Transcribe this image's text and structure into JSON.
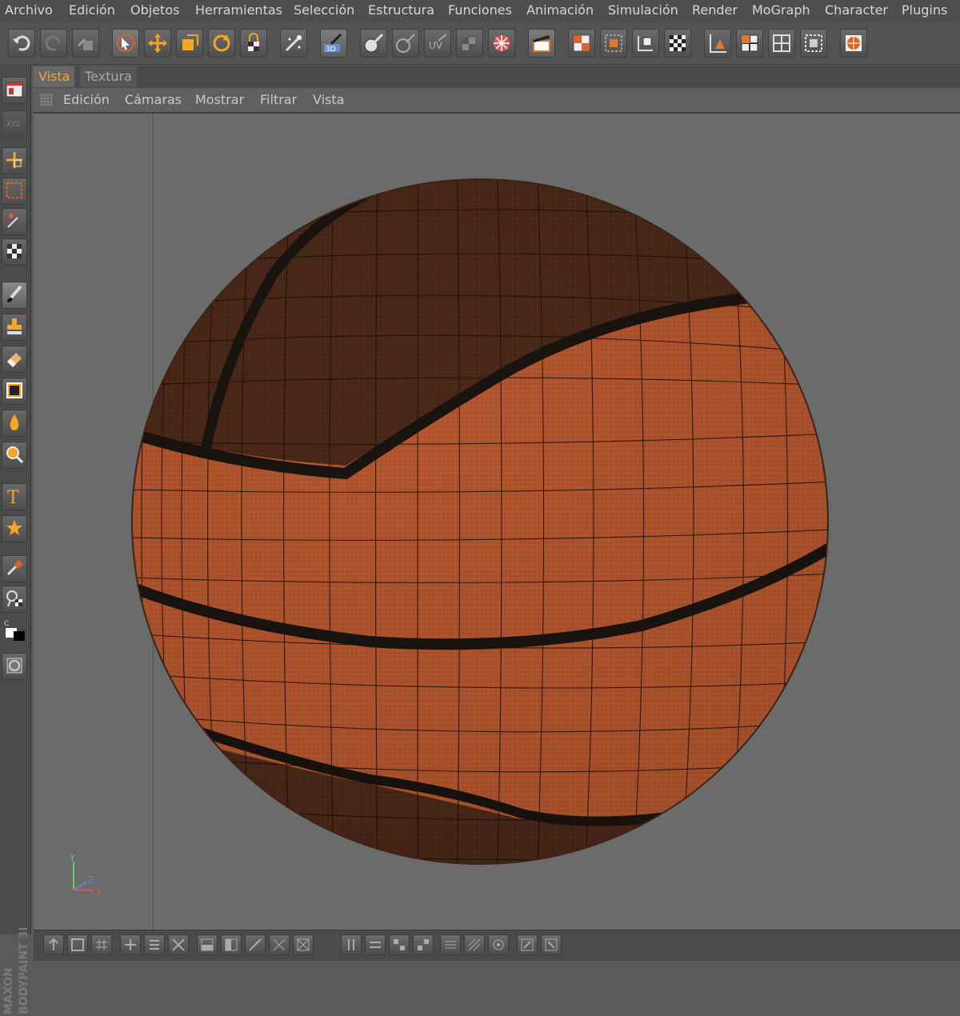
{
  "menu": [
    "Archivo",
    "Edición",
    "Objetos",
    "Herramientas",
    "Selección",
    "Estructura",
    "Funciones",
    "Animación",
    "Simulación",
    "Render",
    "MoGraph",
    "Character",
    "Plugins"
  ],
  "view_tabs": {
    "vista": "Vista",
    "textura": "Textura"
  },
  "view_menu": [
    "Edición",
    "Cámaras",
    "Mostrar",
    "Filtrar",
    "Vista"
  ],
  "axis_labels": {
    "y": "Y",
    "z": "Z",
    "x": "X"
  },
  "brand": {
    "maker": "MAXON",
    "product": "BODYPAINT 3D"
  },
  "colors": {
    "accent": "#f0a24a",
    "ball_orange": "#b4562e",
    "ball_dark": "#4a2818",
    "seam": "#1a1410",
    "viewport": "#6b6b6b"
  }
}
